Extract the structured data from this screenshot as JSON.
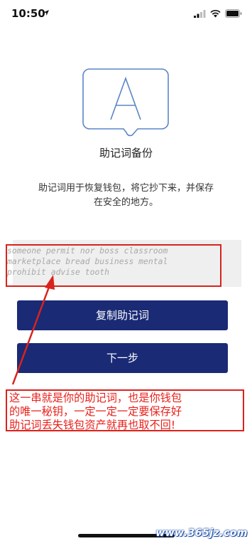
{
  "status_bar": {
    "time": "10:50"
  },
  "logo": {
    "letter": "A"
  },
  "page": {
    "title": "助记词备份",
    "description_line1": "助记词用于恢复钱包，将它抄下来，并保存",
    "description_line2": "在安全的地方。"
  },
  "mnemonic": {
    "line1": "someone permit nor boss classroom",
    "line2": "marketplace bread business mental",
    "line3": "prohibit advise tooth"
  },
  "buttons": {
    "copy_label": "复制助记词",
    "next_label": "下一步"
  },
  "annotation": {
    "line1": "这一串就是你的助记词，也是你钱包",
    "line2": "的唯一秘钥，一定一定一定要保存好",
    "line3": "助记词丢失钱包资产就再也取不回!"
  },
  "watermark": "www.365jz.com",
  "colors": {
    "button_bg": "#1a2a75",
    "annotation_red": "#d9231c",
    "logo_blue": "#5a86c6"
  }
}
